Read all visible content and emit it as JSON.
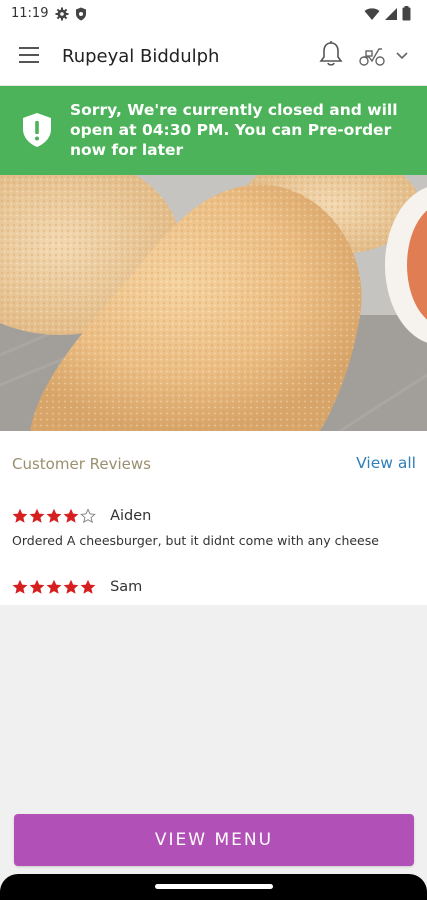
{
  "status_bar": {
    "time": "11:19"
  },
  "app_bar": {
    "title": "Rupeyal Biddulph",
    "icons": [
      "menu-icon",
      "bell-icon",
      "scooter-icon",
      "chevron-down-icon"
    ]
  },
  "banner": {
    "message": "Sorry, We're currently closed and will open at 04:30 PM. You can Pre-order now for later",
    "color": "#4db35a",
    "icon": "shield-alert-icon"
  },
  "reviews": {
    "title": "Customer Reviews",
    "view_all": "View all",
    "star_color": "#d62020",
    "items": [
      {
        "name": "Aiden",
        "rating": 4,
        "max_rating": 5,
        "text": "Ordered A cheesburger, but it didnt come with any cheese"
      },
      {
        "name": "Sam",
        "rating": 5,
        "max_rating": 5
      }
    ]
  },
  "footer": {
    "view_menu_label": "VIEW MENU",
    "button_color": "#b150b6"
  }
}
